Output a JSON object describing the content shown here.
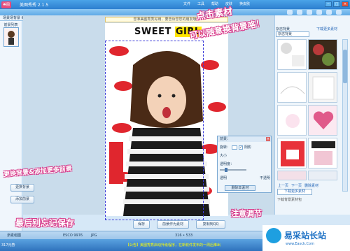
{
  "window": {
    "logo": "美图",
    "title": "美图秀秀 2.1.5",
    "menu": [
      "文件",
      "工具",
      "帮助",
      "皮肤",
      "换皮肤"
    ],
    "buttons": [
      "−",
      "□",
      "×"
    ]
  },
  "left": {
    "tabs": "场景场背景 编辑框",
    "panel_title": "前景列表"
  },
  "notice": "您准美图秀秀好用，要告诉您您的朋友哦！",
  "photo": {
    "title_sweet": "SWEET",
    "title_girl": "GIRL"
  },
  "props": {
    "title": "前景：",
    "rotate_label": "旋转：",
    "shadow_label": "阴影",
    "shadow_checked": true,
    "size_label": "大小",
    "transparency_label": "透明度：",
    "transparent": "透明",
    "opaque": "不透明",
    "delete_label": "删除本素材",
    "transparency_level": 0.2
  },
  "left_buttons": {
    "replace_bg": "更换背景",
    "add_fg": "添加前景"
  },
  "bottom_buttons": {
    "save": "保存",
    "set_fg": "前景作为素材",
    "copy": "复制到QQ"
  },
  "right": {
    "category": "杂志背景",
    "download_link": "下载更多素材",
    "pager": [
      "上一页",
      "下一页",
      "删除素材"
    ],
    "download_button": "下载更多素材",
    "footer": "下载背景素材包"
  },
  "annotations": {
    "top_right_1": "点击素材",
    "top_right_2": "可以随意换背景咯！",
    "left_mid": "更换背景&添加更多前景",
    "bottom_left": "最后别忘记保存",
    "bottom_right": "注意调节"
  },
  "status": {
    "left": "添素组图",
    "size": "ESCO 9976",
    "dims": "JPG",
    "coords": "316 • 533"
  },
  "bottombar": {
    "brand": "317元势",
    "notice": "【公告】美图秀秀启动升级程序，在新软件发布的一周后推出"
  },
  "watermark": {
    "site": "易采站长站",
    "url": "www.Easck.Com"
  },
  "colors": {
    "accent": "#2d7fcf",
    "annotation_pink": "#d83a8a",
    "title_yellow": "#ffe600"
  }
}
